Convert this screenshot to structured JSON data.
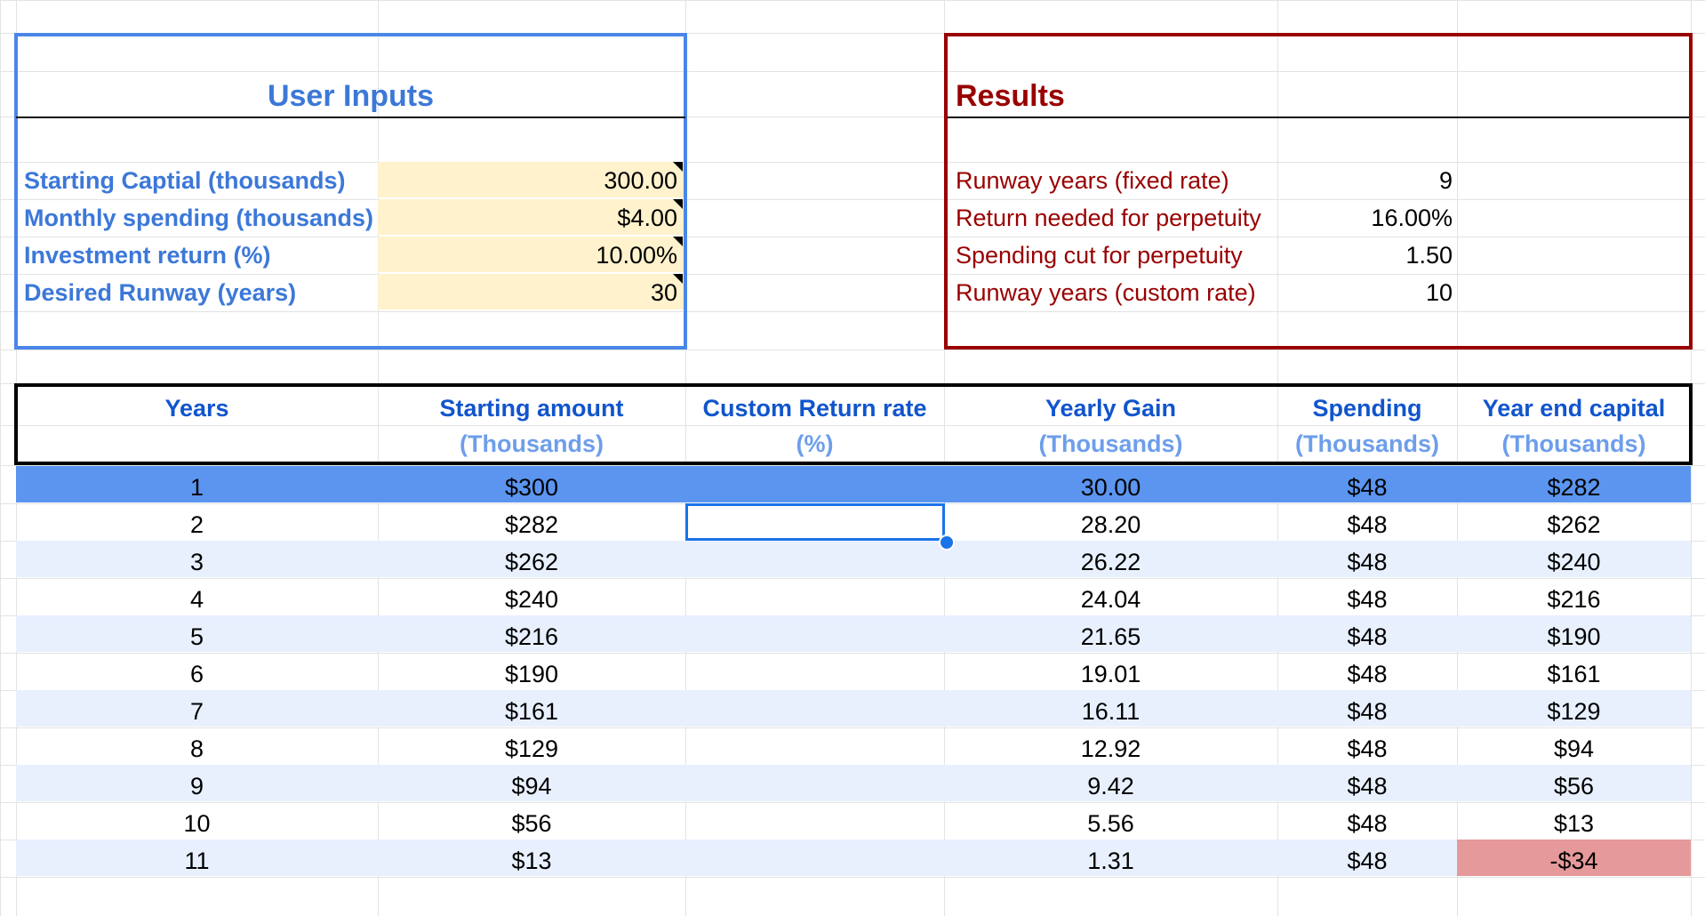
{
  "inputs": {
    "title": "User Inputs",
    "rows": [
      {
        "label": "Starting Captial (thousands)",
        "value": "300.00"
      },
      {
        "label": "Monthly spending (thousands)",
        "value": "$4.00"
      },
      {
        "label": "Investment return (%)",
        "value": "10.00%"
      },
      {
        "label": "Desired Runway (years)",
        "value": "30"
      }
    ]
  },
  "results": {
    "title": "Results",
    "rows": [
      {
        "label": "Runway years (fixed rate)",
        "value": "9"
      },
      {
        "label": "Return needed for perpetuity",
        "value": "16.00%"
      },
      {
        "label": "Spending cut for perpetuity",
        "value": "1.50"
      },
      {
        "label": "Runway years (custom rate)",
        "value": "10"
      }
    ]
  },
  "table": {
    "headers": [
      {
        "title": "Years",
        "sub": ""
      },
      {
        "title": "Starting amount",
        "sub": "(Thousands)"
      },
      {
        "title": "Custom Return rate",
        "sub": "(%)"
      },
      {
        "title": "Yearly Gain",
        "sub": "(Thousands)"
      },
      {
        "title": "Spending",
        "sub": "(Thousands)"
      },
      {
        "title": "Year end capital",
        "sub": "(Thousands)"
      }
    ],
    "rows": [
      [
        "1",
        "$300",
        "",
        "30.00",
        "$48",
        "$282"
      ],
      [
        "2",
        "$282",
        "",
        "28.20",
        "$48",
        "$262"
      ],
      [
        "3",
        "$262",
        "",
        "26.22",
        "$48",
        "$240"
      ],
      [
        "4",
        "$240",
        "",
        "24.04",
        "$48",
        "$216"
      ],
      [
        "5",
        "$216",
        "",
        "21.65",
        "$48",
        "$190"
      ],
      [
        "6",
        "$190",
        "",
        "19.01",
        "$48",
        "$161"
      ],
      [
        "7",
        "$161",
        "",
        "16.11",
        "$48",
        "$129"
      ],
      [
        "8",
        "$129",
        "",
        "12.92",
        "$48",
        "$94"
      ],
      [
        "9",
        "$94",
        "",
        "9.42",
        "$48",
        "$56"
      ],
      [
        "10",
        "$56",
        "",
        "5.56",
        "$48",
        "$13"
      ],
      [
        "11",
        "$13",
        "",
        "1.31",
        "$48",
        "-$34"
      ]
    ],
    "selected_row": 0,
    "negative_cell": {
      "row": 10,
      "col": 5
    }
  },
  "colors": {
    "blue_border": "#4a86e8",
    "red_border": "#990000",
    "title_blue": "#3c78d8",
    "header_blue": "#1155cc",
    "subheader_blue": "#6d9eeb",
    "selected_row": "#5b95f0",
    "alt_band": "#e8f0fe",
    "negative_fill": "#e6999a",
    "input_fill": "#fff2cc",
    "active_cell": "#1a73e8"
  }
}
